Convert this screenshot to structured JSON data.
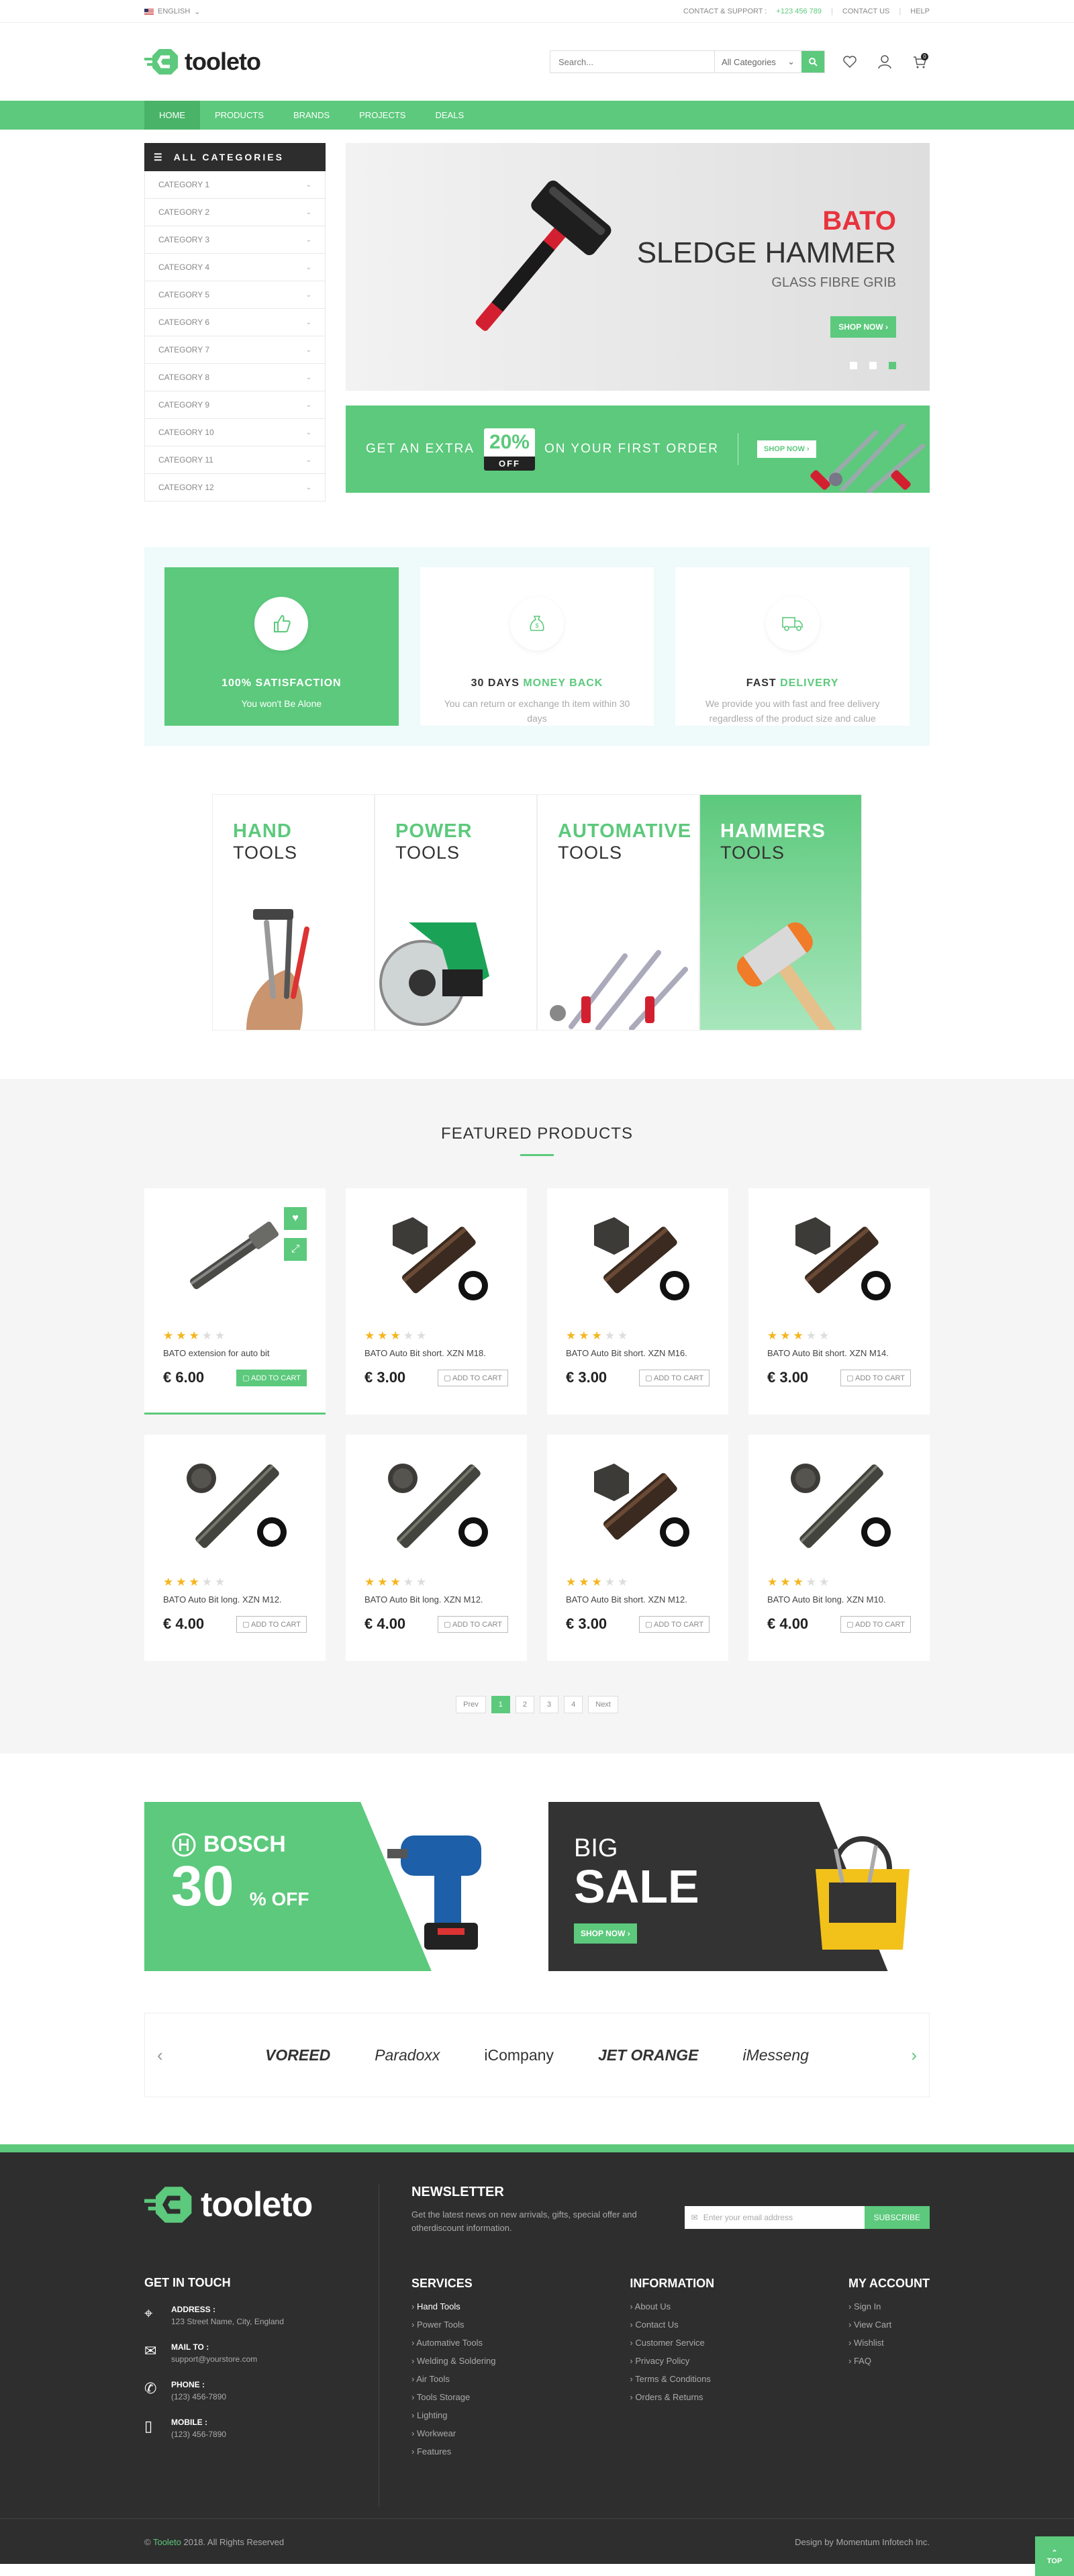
{
  "topbar": {
    "language": "ENGLISH",
    "support_label": "CONTACT & SUPPORT :",
    "support_phone": "+123 456 789",
    "contact": "CONTACT US",
    "help": "HELP"
  },
  "header": {
    "logo": "tooleto",
    "search_placeholder": "Search...",
    "category_select": "All Categories",
    "cart_count": "0"
  },
  "nav": [
    "HOME",
    "PRODUCTS",
    "BRANDS",
    "PROJECTS",
    "DEALS"
  ],
  "categories": {
    "title": "ALL CATEGORIES",
    "items": [
      "CATEGORY 1",
      "CATEGORY 2",
      "CATEGORY 3",
      "CATEGORY 4",
      "CATEGORY 5",
      "CATEGORY 6",
      "CATEGORY 7",
      "CATEGORY 8",
      "CATEGORY 9",
      "CATEGORY 10",
      "CATEGORY 11",
      "CATEGORY 12"
    ]
  },
  "slider": {
    "brand": "BATO",
    "title": "SLEDGE HAMMER",
    "subtitle": "GLASS FIBRE GRIB",
    "button": "SHOP NOW",
    "active_dot": 3
  },
  "promo": {
    "left": "GET AN EXTRA",
    "percent": "20%",
    "off": "OFF",
    "right": "ON YOUR FIRST ORDER",
    "button": "SHOP NOW"
  },
  "features": [
    {
      "title": "100% SATISFACTION",
      "title_accent": "",
      "text": "You won't Be Alone",
      "icon": "thumbs-up-icon"
    },
    {
      "title": "30 DAYS ",
      "title_accent": "MONEY BACK",
      "text": "You can return or exchange th item within 30 days",
      "icon": "money-bag-icon"
    },
    {
      "title": "FAST ",
      "title_accent": "DELIVERY",
      "text": "We provide you with fast and free delivery regardless of the  product size and calue",
      "icon": "truck-icon"
    }
  ],
  "tiles": [
    {
      "a": "HAND",
      "b": "TOOLS"
    },
    {
      "a": "POWER",
      "b": "TOOLS"
    },
    {
      "a": "AUTOMATIVE",
      "b": "TOOLS"
    },
    {
      "a": "HAMMERS",
      "b": "TOOLS"
    }
  ],
  "featured": {
    "title": "FEATURED PRODUCTS",
    "add_to_cart": "ADD TO CART",
    "products": [
      {
        "name": "BATO extension for auto bit",
        "price": "€ 6.00",
        "rating": 3,
        "img": "extension"
      },
      {
        "name": "BATO Auto Bit short. XZN M18.",
        "price": "€ 3.00",
        "rating": 3,
        "img": "short"
      },
      {
        "name": "BATO Auto Bit short. XZN M16.",
        "price": "€ 3.00",
        "rating": 3,
        "img": "short"
      },
      {
        "name": "BATO Auto Bit short. XZN M14.",
        "price": "€ 3.00",
        "rating": 3,
        "img": "short"
      },
      {
        "name": "BATO Auto Bit long. XZN M12.",
        "price": "€ 4.00",
        "rating": 3,
        "img": "long"
      },
      {
        "name": "BATO Auto Bit long. XZN M12.",
        "price": "€ 4.00",
        "rating": 3,
        "img": "long"
      },
      {
        "name": "BATO Auto Bit short. XZN M12.",
        "price": "€ 3.00",
        "rating": 3,
        "img": "short"
      },
      {
        "name": "BATO Auto Bit long. XZN M10.",
        "price": "€ 4.00",
        "rating": 3,
        "img": "long"
      }
    ],
    "pager": {
      "prev": "Prev",
      "pages": [
        "1",
        "2",
        "3",
        "4"
      ],
      "next": "Next",
      "current": "1"
    }
  },
  "banners": {
    "bosch_brand": "BOSCH",
    "bosch_pct": "30",
    "bosch_pct_sign": "%",
    "bosch_off": "OFF",
    "sale_line1": "BIG",
    "sale_line2": "SALE",
    "sale_button": "SHOP NOW"
  },
  "brands": [
    "VOREED",
    "Paradoxx",
    "iCompany",
    "JET ORANGE",
    "iMesseng"
  ],
  "footer": {
    "logo": "tooleto",
    "get_in_touch": "GET IN TOUCH",
    "contacts": [
      {
        "label": "ADDRESS :",
        "value": "123 Street Name, City, England",
        "icon": "pin-icon"
      },
      {
        "label": "MAIL TO :",
        "value": "support@yourstore.com",
        "icon": "mail-icon"
      },
      {
        "label": "PHONE :",
        "value": "(123) 456-7890",
        "icon": "phone-icon"
      },
      {
        "label": "MOBILE :",
        "value": "(123) 456-7890",
        "icon": "mobile-icon"
      }
    ],
    "newsletter_title": "NEWSLETTER",
    "newsletter_text": "Get the latest news on new arrivals, gifts, special offer and otherdiscount information.",
    "email_placeholder": "Enter your email address",
    "subscribe": "SUBSCRIBE",
    "services_title": "SERVICES",
    "services": [
      "Hand Tools",
      "Power Tools",
      "Automative Tools",
      "Welding & Soldering",
      "Air Tools",
      "Tools Storage",
      "Lighting",
      "Workwear",
      "Features"
    ],
    "info_title": "INFORMATION",
    "info": [
      "About Us",
      "Contact Us",
      "Customer Service",
      "Privacy Policy",
      "Terms & Conditions",
      "Orders & Returns"
    ],
    "account_title": "MY ACCOUNT",
    "account": [
      "Sign In",
      "View Cart",
      "Wishlist",
      "FAQ"
    ],
    "copyright_brand": "Tooleto",
    "copyright": " 2018. All Rights Reserved",
    "design": "Design by Momentum Infotech Inc.",
    "top": "TOP"
  },
  "colors": {
    "accent": "#5cc97c",
    "dark": "#2e2e2e",
    "red": "#e8333d"
  }
}
